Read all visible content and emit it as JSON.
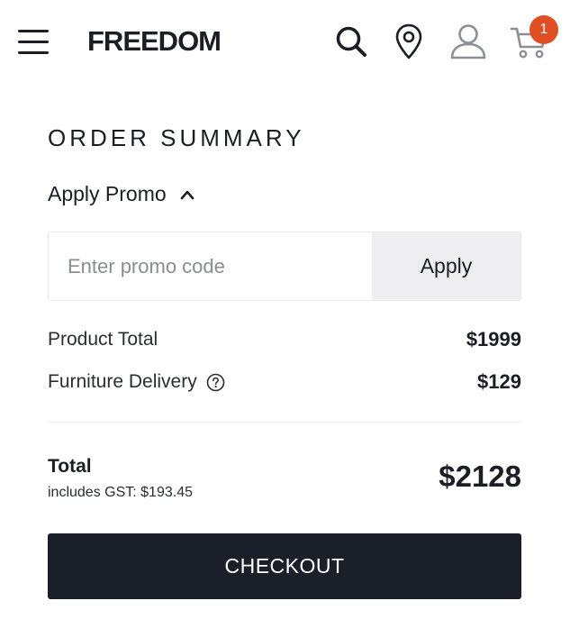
{
  "header": {
    "logo": "FREEDOM",
    "cart_count": "1",
    "icons": [
      "menu-icon",
      "search-icon",
      "location-icon",
      "user-icon",
      "cart-icon"
    ],
    "accent_color": "#e04e24"
  },
  "summary": {
    "title": "ORDER SUMMARY",
    "promo_toggle_label": "Apply Promo",
    "promo_placeholder": "Enter promo code",
    "promo_value": "",
    "apply_label": "Apply",
    "lines": [
      {
        "label": "Product Total",
        "value": "$1999"
      },
      {
        "label": "Furniture Delivery",
        "value": "$129"
      }
    ],
    "total_label": "Total",
    "gst_text": "includes GST: $193.45",
    "total_value": "$2128",
    "checkout_label": "CHECKOUT",
    "checkout_color": "#1b1f29"
  }
}
